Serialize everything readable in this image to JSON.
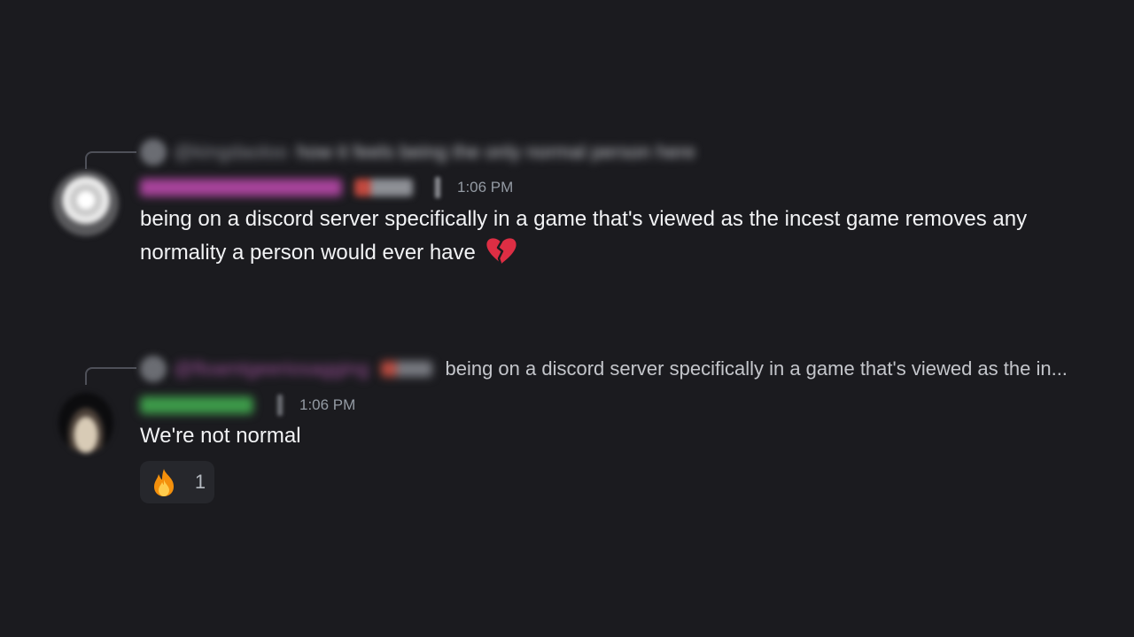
{
  "messages": [
    {
      "reply": {
        "author": "@kingdaoloo",
        "snippet": "how it feels being the only normal person here"
      },
      "author": "floamtgeeriosagging",
      "badge": "LDK",
      "timestamp": "1:06 PM",
      "content": "being on a discord server specifically in a game that's viewed as the incest game removes any normality a person would ever have",
      "emoji": "broken-heart-icon",
      "name_color": "#b44fa8"
    },
    {
      "reply": {
        "author": "@floamtgeeriosagging",
        "badge": "LDK",
        "snippet": "being on a discord server specifically in a game that's viewed as the in..."
      },
      "author": "Emey",
      "timestamp": "1:06 PM",
      "content": "We're not normal",
      "name_color": "#3fa54c",
      "reaction": {
        "emoji": "fire-icon",
        "count": "1"
      }
    }
  ],
  "colors": {
    "background": "#1b1b1f",
    "timestamp": "#949ba4",
    "text": "#f2f3f5",
    "reaction_bg": "#26272c"
  }
}
